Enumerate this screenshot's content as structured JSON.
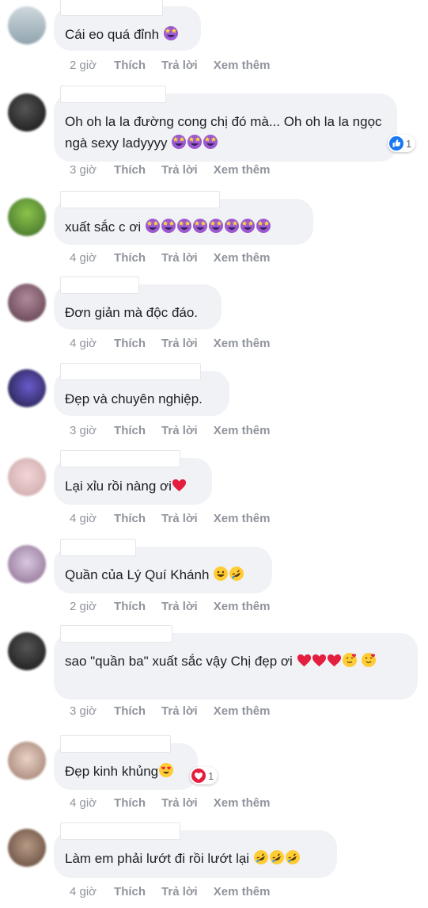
{
  "actions": {
    "like": "Thích",
    "reply": "Trả lời",
    "more": "Xem thêm"
  },
  "comments": [
    {
      "text": "Cái eo quá đỉnh",
      "time": "2 giờ"
    },
    {
      "text": "Oh oh la la đường cong chị đó mà... Oh oh la la ngọc ngà sexy ladyyyy",
      "time": "3 giờ",
      "reaction_count": "1"
    },
    {
      "text": "xuất sắc c ơi",
      "time": "4 giờ"
    },
    {
      "text": "Đơn giản mà độc đáo.",
      "time": "4 giờ"
    },
    {
      "text": "Đẹp và chuyên nghiệp.",
      "time": "3 giờ"
    },
    {
      "text": "Lại xỉu rồi nàng ơi",
      "time": "4 giờ"
    },
    {
      "text": "Quần của Lý Quí Khánh",
      "time": "2 giờ"
    },
    {
      "text": "sao \"quần ba\" xuất sắc vậy Chị đẹp ơi",
      "time": "3 giờ"
    },
    {
      "text": "Đẹp kinh khủng",
      "time": "4 giờ",
      "reaction_count": "1"
    },
    {
      "text": "Làm em phải lướt đi rồi lướt lại",
      "time": "4 giờ"
    }
  ],
  "colors": {
    "bubble": "#f0f2f5",
    "meta": "#90949c",
    "like_blue": "#1877f2",
    "heart": "#e41e3f"
  }
}
